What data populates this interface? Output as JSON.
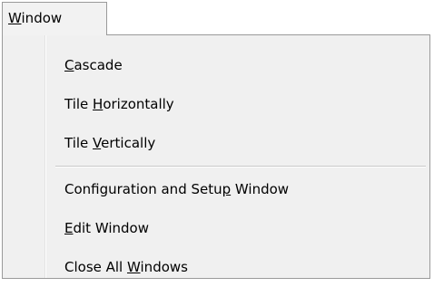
{
  "menubar": {
    "window_menu": {
      "mnemonic": "W",
      "rest": "indow"
    }
  },
  "menu": {
    "items": [
      {
        "before": "",
        "mnemonic": "C",
        "after": "ascade"
      },
      {
        "before": "Tile ",
        "mnemonic": "H",
        "after": "orizontally"
      },
      {
        "before": "Tile ",
        "mnemonic": "V",
        "after": "ertically"
      },
      {
        "before": "Configuration and Setu",
        "mnemonic": "p",
        "after": " Window"
      },
      {
        "before": "",
        "mnemonic": "E",
        "after": "dit Window"
      },
      {
        "before": "Close All ",
        "mnemonic": "W",
        "after": "indows"
      }
    ]
  }
}
